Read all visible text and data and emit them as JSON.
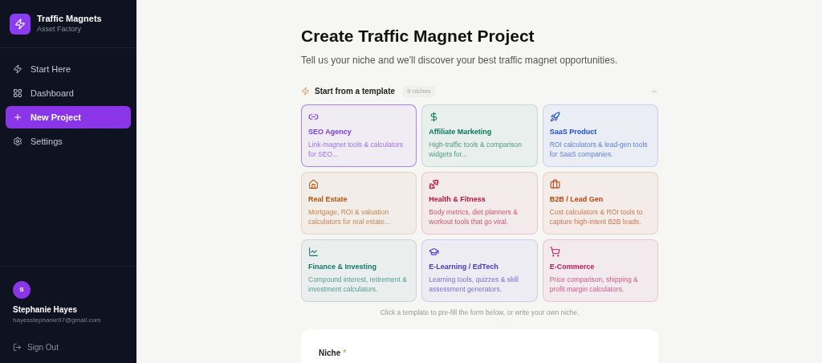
{
  "brand": {
    "name": "Traffic Magnets",
    "tagline": "Asset Factory"
  },
  "nav": [
    {
      "label": "Start Here",
      "selected": false
    },
    {
      "label": "Dashboard",
      "selected": false
    },
    {
      "label": "New Project",
      "selected": true
    },
    {
      "label": "Settings",
      "selected": false
    }
  ],
  "user": {
    "initial": "S",
    "name": "Stephanie Hayes",
    "email": "hayesstephanie97@gmail.com"
  },
  "sign_out": "Sign Out",
  "title": "Create Traffic Magnet Project",
  "subtitle": "Tell us your niche and we'll discover your best traffic magnet opportunities.",
  "templates": {
    "heading": "Start from a template",
    "count": "9 niches",
    "expanded": true,
    "items": [
      {
        "title": "SEO Agency",
        "description": "Link-magnet tools & calculators for SEO...",
        "color": "#7c3aed",
        "selected": true
      },
      {
        "title": "Affiliate Marketing",
        "description": "High-traffic tools & comparison widgets for...",
        "color": "#047857",
        "selected": false
      },
      {
        "title": "SaaS Product",
        "description": "ROI calculators & lead-gen tools for SaaS companies.",
        "color": "#1d4ed8",
        "selected": false
      },
      {
        "title": "Real Estate",
        "description": "Mortgage, ROI & valuation calculators for real estate...",
        "color": "#b45309",
        "selected": false
      },
      {
        "title": "Health & Fitness",
        "description": "Body metrics, diet planners & workout tools that go viral.",
        "color": "#be123c",
        "selected": false
      },
      {
        "title": "B2B / Lead Gen",
        "description": "Cost calculators & ROI tools to capture high-intent B2B leads.",
        "color": "#c2410c",
        "selected": false
      },
      {
        "title": "Finance & Investing",
        "description": "Compound interest, retirement & investment calculators.",
        "color": "#0f766e",
        "selected": false
      },
      {
        "title": "E-Learning / EdTech",
        "description": "Learning tools, quizzes & skill assessment generators.",
        "color": "#4338ca",
        "selected": false
      },
      {
        "title": "E-Commerce",
        "description": "Price comparison, shipping & profit margin calculators.",
        "color": "#be185d",
        "selected": false
      }
    ],
    "hint": "Click a template to pre-fill the form below, or write your own niche."
  },
  "form": {
    "label": "Niche",
    "required_mark": "*"
  }
}
